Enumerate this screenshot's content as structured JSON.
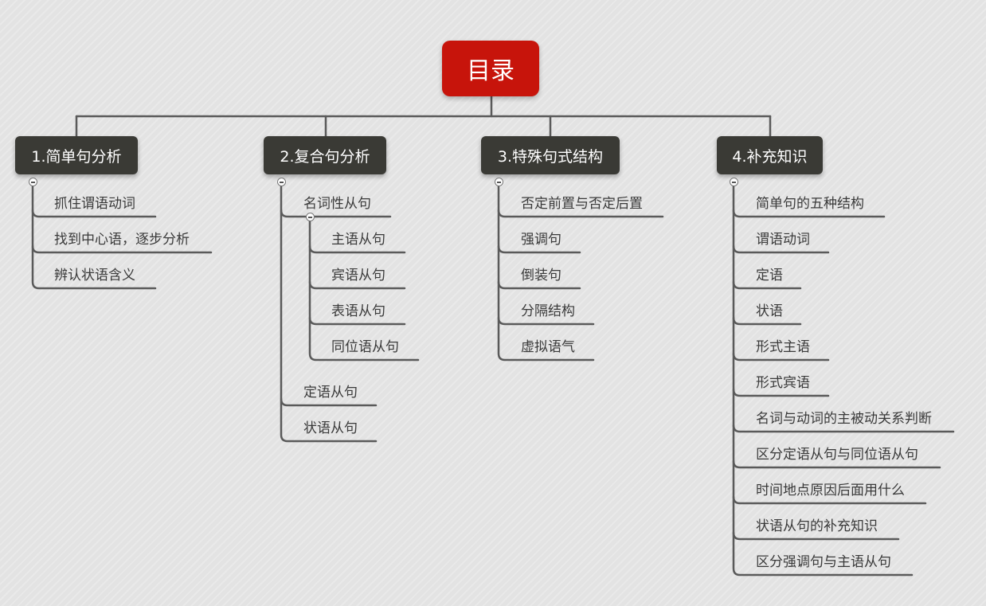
{
  "root": {
    "label": "目录"
  },
  "branches": [
    {
      "label": "1.简单句分析",
      "items": [
        "抓住谓语动词",
        "找到中心语，逐步分析",
        "辨认状语含义"
      ]
    },
    {
      "label": "2.复合句分析",
      "group": {
        "label": "名词性从句",
        "items": [
          "主语从句",
          "宾语从句",
          "表语从句",
          "同位语从句"
        ]
      },
      "items": [
        "定语从句",
        "状语从句"
      ]
    },
    {
      "label": "3.特殊句式结构",
      "items": [
        "否定前置与否定后置",
        "强调句",
        "倒装句",
        "分隔结构",
        "虚拟语气"
      ]
    },
    {
      "label": "4.补充知识",
      "items": [
        "简单句的五种结构",
        "谓语动词",
        "定语",
        "状语",
        "形式主语",
        "形式宾语",
        "名词与动词的主被动关系判断",
        "区分定语从句与同位语从句",
        "时间地点原因后面用什么",
        "状语从句的补充知识",
        "区分强调句与主语从句"
      ]
    }
  ],
  "colors": {
    "root": "#c7140b",
    "branch": "#3a3a35",
    "line": "#5a5a5a",
    "text": "#3a3a3a"
  },
  "icons": {
    "toggle": "collapse-icon"
  }
}
